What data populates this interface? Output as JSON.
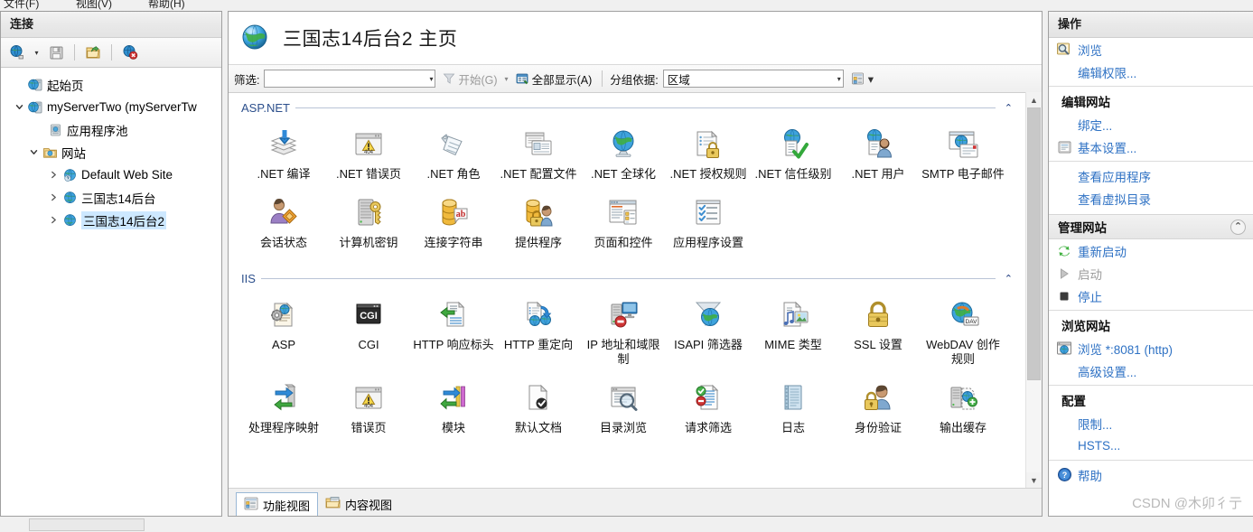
{
  "menubar": {
    "items": [
      "文件(F)",
      "视图(V)",
      "帮助(H)"
    ]
  },
  "connections": {
    "title": "连接",
    "toolbar": [
      {
        "name": "connect-to-icon",
        "label": "连接到"
      },
      {
        "name": "save-icon",
        "label": "保存连接"
      },
      {
        "name": "export-icon",
        "label": "导出"
      },
      {
        "name": "disconnect-icon",
        "label": "断开连接"
      }
    ],
    "tree": [
      {
        "label": "起始页",
        "icon": "start-page-icon",
        "depth": 0,
        "expander": "",
        "selected": false
      },
      {
        "label": "myServerTwo (myServerTw",
        "icon": "server-icon",
        "depth": 0,
        "expander": "v",
        "selected": false
      },
      {
        "label": "应用程序池",
        "icon": "app-pool-icon",
        "depth": 1,
        "expander": "",
        "selected": false
      },
      {
        "label": "网站",
        "icon": "sites-folder-icon",
        "depth": 1,
        "expander": "v",
        "selected": false
      },
      {
        "label": "Default Web Site",
        "icon": "website-icon",
        "depth": 2,
        "expander": ">",
        "selected": false
      },
      {
        "label": "三国志14后台",
        "icon": "website-icon",
        "depth": 2,
        "expander": ">",
        "selected": false
      },
      {
        "label": "三国志14后台2",
        "icon": "website-icon",
        "depth": 2,
        "expander": ">",
        "selected": true
      }
    ]
  },
  "page": {
    "icon": "globe-icon",
    "title": "三国志14后台2 主页"
  },
  "filterbar": {
    "filter_label": "筛选:",
    "filter_value": "",
    "filter_placeholder": "",
    "go_label": "开始(G)",
    "show_all_label": "全部显示(A)",
    "group_by_label": "分组依据:",
    "group_by_value": "区域",
    "view_label": ""
  },
  "groups": [
    {
      "name": "ASP.NET",
      "items": [
        {
          "label": ".NET 编译",
          "icon": "net-compilation-icon"
        },
        {
          "label": ".NET 错误页",
          "icon": "net-error-pages-icon"
        },
        {
          "label": ".NET 角色",
          "icon": "net-roles-icon"
        },
        {
          "label": ".NET 配置文件",
          "icon": "net-profile-icon"
        },
        {
          "label": ".NET 全球化",
          "icon": "net-globalization-icon"
        },
        {
          "label": ".NET 授权规则",
          "icon": "net-authorization-rules-icon"
        },
        {
          "label": ".NET 信任级别",
          "icon": "net-trust-levels-icon"
        },
        {
          "label": ".NET 用户",
          "icon": "net-users-icon"
        },
        {
          "label": "SMTP 电子邮件",
          "icon": "smtp-email-icon"
        },
        {
          "label": "会话状态",
          "icon": "session-state-icon"
        },
        {
          "label": "计算机密钥",
          "icon": "machine-key-icon"
        },
        {
          "label": "连接字符串",
          "icon": "connection-strings-icon"
        },
        {
          "label": "提供程序",
          "icon": "providers-icon"
        },
        {
          "label": "页面和控件",
          "icon": "pages-and-controls-icon"
        },
        {
          "label": "应用程序设置",
          "icon": "application-settings-icon"
        }
      ]
    },
    {
      "name": "IIS",
      "items": [
        {
          "label": "ASP",
          "icon": "asp-icon"
        },
        {
          "label": "CGI",
          "icon": "cgi-icon"
        },
        {
          "label": "HTTP 响应标头",
          "icon": "http-response-headers-icon"
        },
        {
          "label": "HTTP 重定向",
          "icon": "http-redirect-icon"
        },
        {
          "label": "IP 地址和域限制",
          "icon": "ip-address-domain-restrictions-icon"
        },
        {
          "label": "ISAPI 筛选器",
          "icon": "isapi-filters-icon"
        },
        {
          "label": "MIME 类型",
          "icon": "mime-types-icon"
        },
        {
          "label": "SSL 设置",
          "icon": "ssl-settings-icon"
        },
        {
          "label": "WebDAV 创作规则",
          "icon": "webdav-authoring-rules-icon"
        },
        {
          "label": "处理程序映射",
          "icon": "handler-mappings-icon"
        },
        {
          "label": "错误页",
          "icon": "error-pages-icon"
        },
        {
          "label": "模块",
          "icon": "modules-icon"
        },
        {
          "label": "默认文档",
          "icon": "default-document-icon"
        },
        {
          "label": "目录浏览",
          "icon": "directory-browsing-icon"
        },
        {
          "label": "请求筛选",
          "icon": "request-filtering-icon"
        },
        {
          "label": "日志",
          "icon": "logging-icon"
        },
        {
          "label": "身份验证",
          "icon": "authentication-icon"
        },
        {
          "label": "输出缓存",
          "icon": "output-caching-icon"
        }
      ]
    }
  ],
  "view_tabs": [
    {
      "label": "功能视图",
      "icon": "features-view-icon",
      "active": true
    },
    {
      "label": "内容视图",
      "icon": "content-view-icon",
      "active": false
    }
  ],
  "actions": {
    "title": "操作",
    "sections": [
      {
        "header": null,
        "items": [
          {
            "label": "浏览",
            "icon": "browse-icon",
            "disabled": false
          },
          {
            "label": "编辑权限...",
            "icon": null,
            "disabled": false
          }
        ]
      },
      {
        "header": "编辑网站",
        "shaded": false,
        "items": [
          {
            "label": "绑定...",
            "icon": null,
            "disabled": false
          },
          {
            "label": "基本设置...",
            "icon": "basic-settings-icon",
            "disabled": false
          }
        ]
      },
      {
        "header": null,
        "items": [
          {
            "label": "查看应用程序",
            "icon": null,
            "disabled": false
          },
          {
            "label": "查看虚拟目录",
            "icon": null,
            "disabled": false
          }
        ]
      },
      {
        "header": "管理网站",
        "shaded": true,
        "collapse": "chevron-up-icon",
        "items": [
          {
            "label": "重新启动",
            "icon": "restart-icon",
            "disabled": false
          },
          {
            "label": "启动",
            "icon": "start-icon",
            "disabled": true
          },
          {
            "label": "停止",
            "icon": "stop-icon",
            "disabled": false
          }
        ]
      },
      {
        "header": "浏览网站",
        "shaded": false,
        "items": [
          {
            "label": "浏览 *:8081 (http)",
            "icon": "browse-site-icon",
            "disabled": false
          },
          {
            "label": "高级设置...",
            "icon": null,
            "disabled": false
          }
        ]
      },
      {
        "header": "配置",
        "shaded": false,
        "items": [
          {
            "label": "限制...",
            "icon": null,
            "disabled": false
          },
          {
            "label": "HSTS...",
            "icon": null,
            "disabled": false
          }
        ]
      },
      {
        "header": null,
        "items": [
          {
            "label": "帮助",
            "icon": "help-icon",
            "disabled": false
          }
        ]
      }
    ]
  },
  "watermark": "CSDN @木卯彳亍",
  "colors": {
    "group_header": "#2c4f8c",
    "link": "#2f72c4",
    "selection": "#cde8ff",
    "pane_border": "#a0a0a0"
  }
}
